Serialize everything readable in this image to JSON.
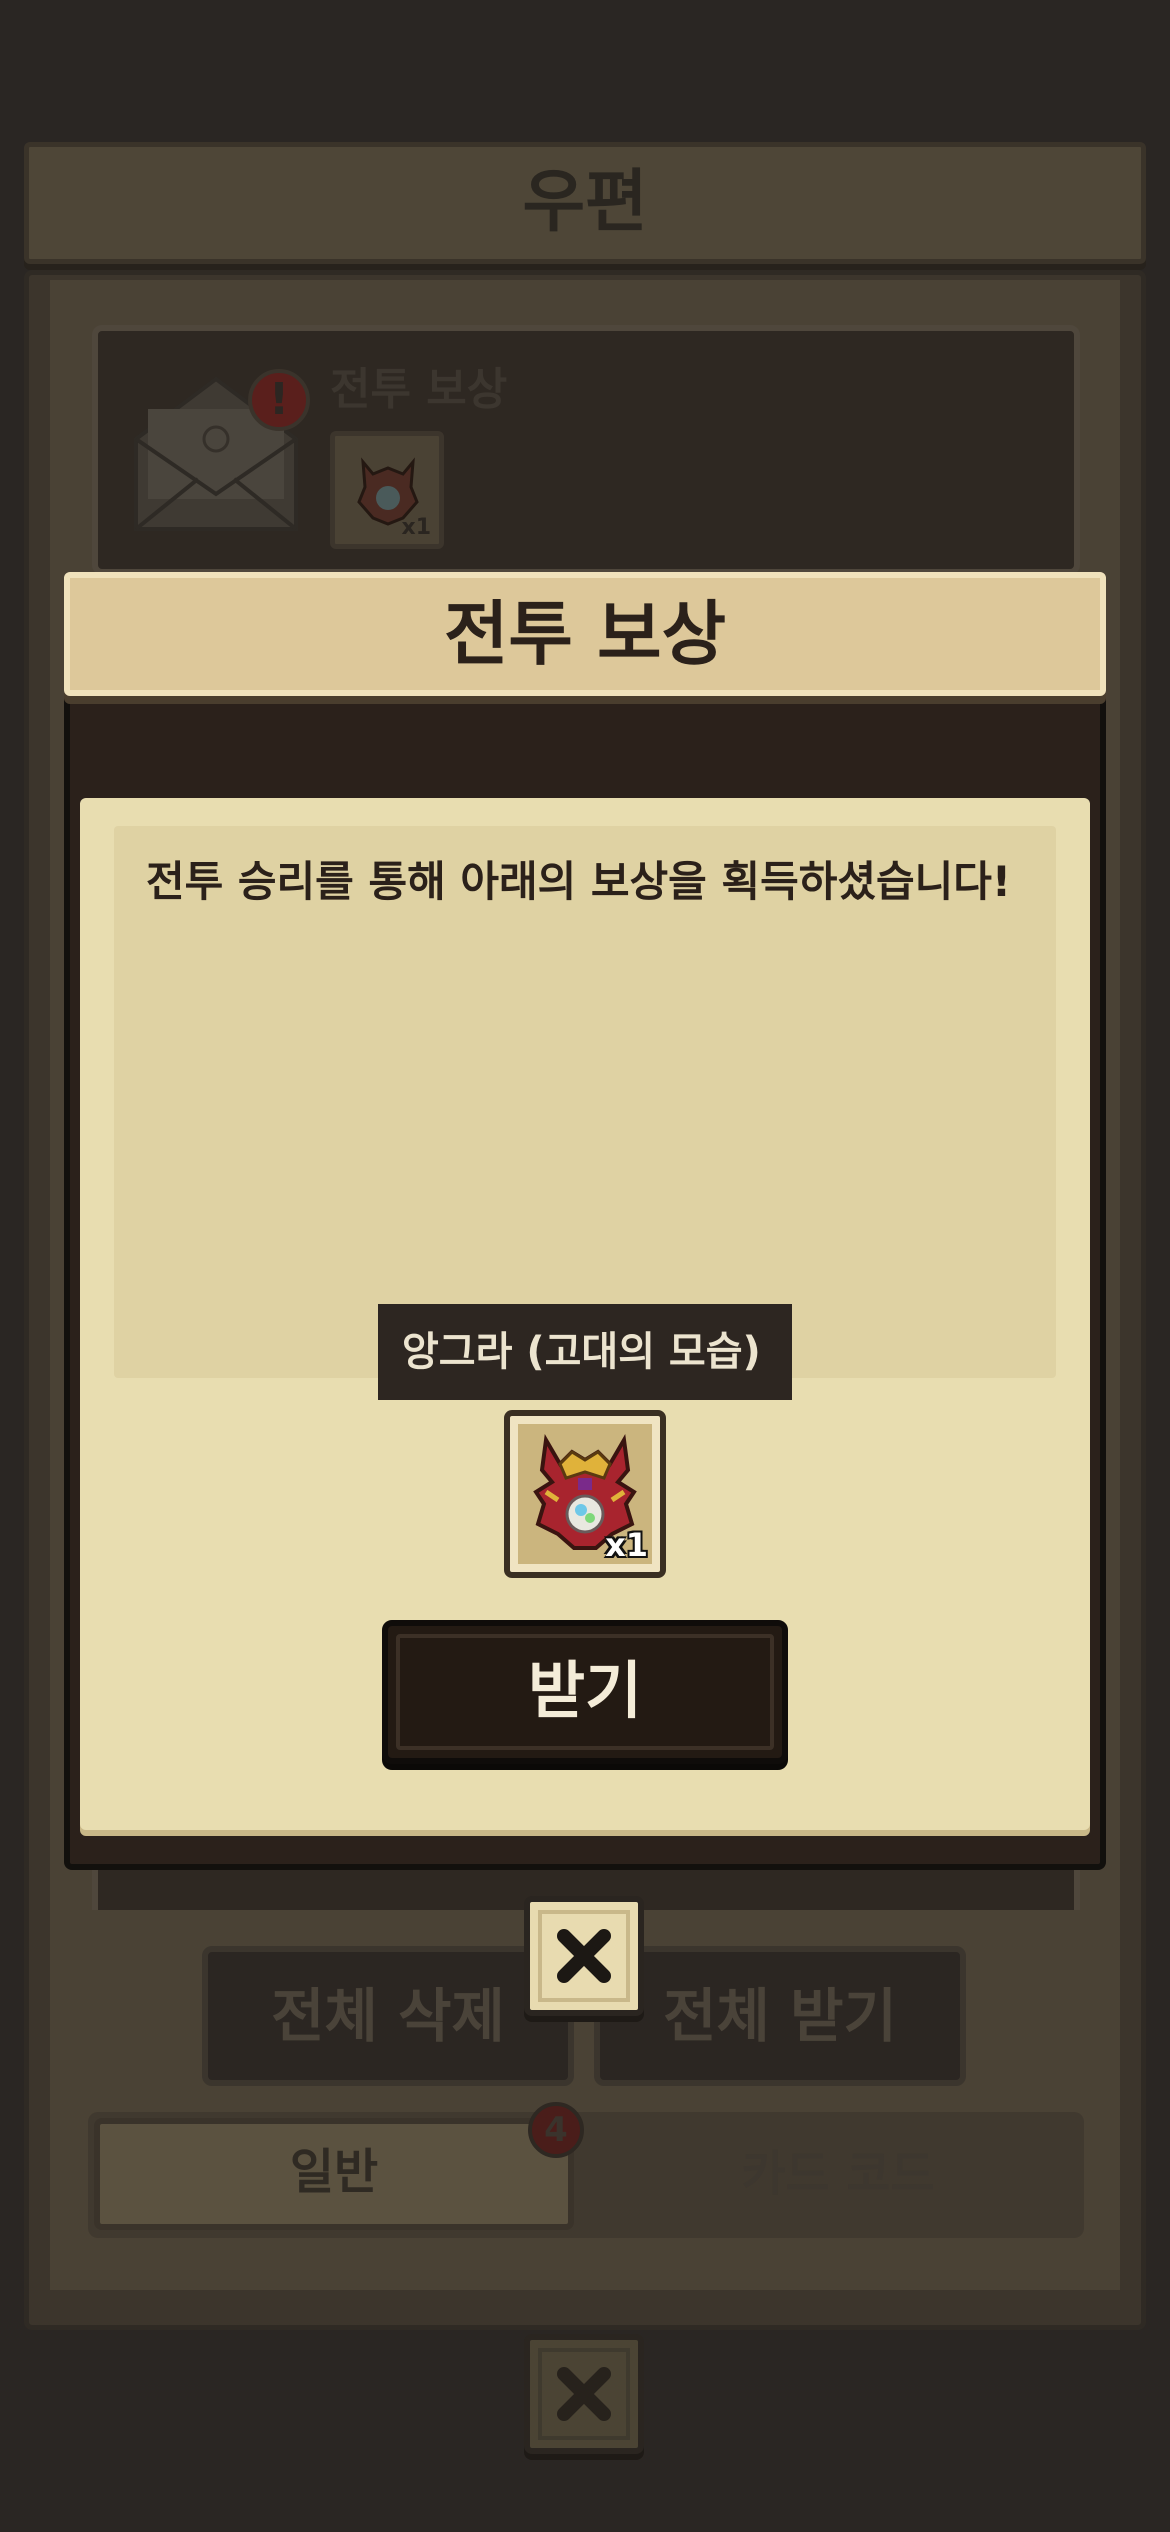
{
  "mailbox": {
    "title": "우편",
    "mail_items": [
      {
        "title": "전투 보상",
        "quantity": "x1",
        "icon": "angra-relic-icon"
      }
    ],
    "delete_all_label": "전체 삭제",
    "receive_all_label": "전체 받기",
    "tabs": [
      {
        "label": "일반",
        "badge": "4"
      },
      {
        "label": "카드 코드"
      }
    ],
    "close_icon": "close-icon"
  },
  "popup": {
    "title": "전투 보상",
    "message": "전투 승리를 통해 아래의 보상을 획득하셨습니다!",
    "tooltip": "앙그라 (고대의 모습)",
    "reward": {
      "quantity": "x1",
      "icon": "angra-relic-icon"
    },
    "receive_label": "받기",
    "close_icon": "close-icon"
  },
  "colors": {
    "paper": "#e8ddb0",
    "dark_panel": "#2b211b",
    "title_banner": "#ddc89a",
    "alert_red": "#c0392b"
  }
}
